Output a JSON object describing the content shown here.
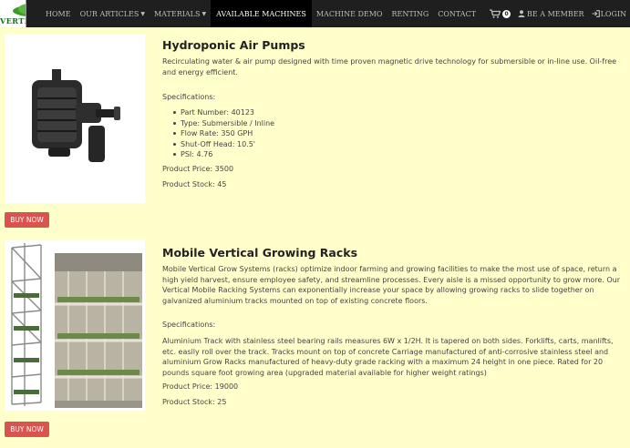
{
  "brand": {
    "name": "VERTIFARM"
  },
  "nav": {
    "items": [
      {
        "label": "HOME",
        "caret": false,
        "active": false
      },
      {
        "label": "OUR ARTICLES",
        "caret": true,
        "active": false
      },
      {
        "label": "MATERIALS",
        "caret": true,
        "active": false
      },
      {
        "label": "AVAILABLE MACHINES",
        "caret": false,
        "active": true
      },
      {
        "label": "MACHINE DEMO",
        "caret": false,
        "active": false
      },
      {
        "label": "RENTING",
        "caret": false,
        "active": false
      },
      {
        "label": "CONTACT",
        "caret": false,
        "active": false
      }
    ],
    "cart_count": "0",
    "member_label": "BE A MEMBER",
    "login_label": "LOGIN"
  },
  "products": [
    {
      "title": "Hydroponic Air Pumps",
      "description": "Recirculating water & air pump designed with time proven magnetic drive technology for submersible or in-line use. Oil-free and energy efficient.",
      "specs_label": "Specifications:",
      "specs": [
        "Part Number: 40123",
        "Type: Submersible / Inline",
        "Flow Rate: 350 GPH",
        "Shut-Off Head: 10.5'",
        "PSI: 4.76"
      ],
      "price": "Product Price: 3500",
      "stock": "Product Stock: 45",
      "buy_label": "BUY NOW"
    },
    {
      "title": "Mobile Vertical Growing Racks",
      "description": "Mobile Vertical Grow Systems (racks) optimize indoor farming and growing facilities to make the most use of space, return a high yield harvest, ensure employee safety, and streamline processes. Every aisle is a missed opportunity to grow more. Our Vertical Mobile Racking Systems can exponentially increase your space by allowing growing racks to slide together on galvanized aluminium tracks mounted on top of existing concrete floors.",
      "specs_label": "Specifications:",
      "specs_text": "Aluminium Track with stainless steel bearing rails measures 6W x 1/2H. It is tapered on both sides. Forklifts, carts, manlifts, etc. easily roll over the track. Tracks mount on top of concrete Carriage manufactured of anti-corrosive stainless steel and aluminium Grow Racks manufactured of heavy-duty grade racking with a maximum 24 height in one piece. Rated for 20 pounds square foot growing area (upgraded material available for higher weight ratings)",
      "price": "Product Price: 19000",
      "stock": "Product Stock: 25",
      "buy_label": "BUY NOW"
    }
  ]
}
